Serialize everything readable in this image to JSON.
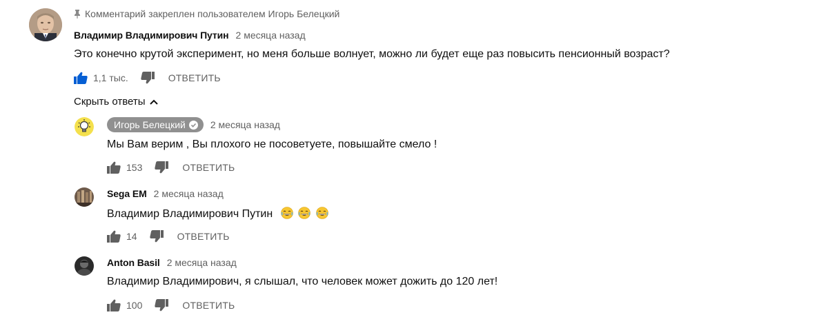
{
  "pinned": {
    "text": "Комментарий закреплен пользователем Игорь Белецкий",
    "icon": "pin-icon"
  },
  "main_comment": {
    "author": "Владимир Владимирович Путин",
    "date": "2 месяца назад",
    "text": "Это конечно крутой эксперимент, но  меня больше волнует, можно ли будет еще раз повысить пенсионный возраст?",
    "likes": "1,1 тыс.",
    "reply_label": "ОТВЕТИТЬ",
    "like_color": "#065fd4"
  },
  "hide_replies_label": "Скрыть ответы",
  "replies": [
    {
      "author": "Игорь Белецкий",
      "is_channel_owner": true,
      "date": "2 месяца назад",
      "text": "Мы Вам верим , Вы плохого не посоветуете, повышайте смело !",
      "likes": "153",
      "reply_label": "ОТВЕТИТЬ"
    },
    {
      "author": "Sega EM",
      "date": "2 месяца назад",
      "text": "Владимир Владимирович Путин",
      "emoji_count": 3,
      "likes": "14",
      "reply_label": "ОТВЕТИТЬ"
    },
    {
      "author": "Anton Basil",
      "date": "2 месяца назад",
      "text": "Владимир Владимирович, я слышал, что человек может дожить до 120 лет!",
      "likes": "100",
      "reply_label": "ОТВЕТИТЬ"
    }
  ]
}
